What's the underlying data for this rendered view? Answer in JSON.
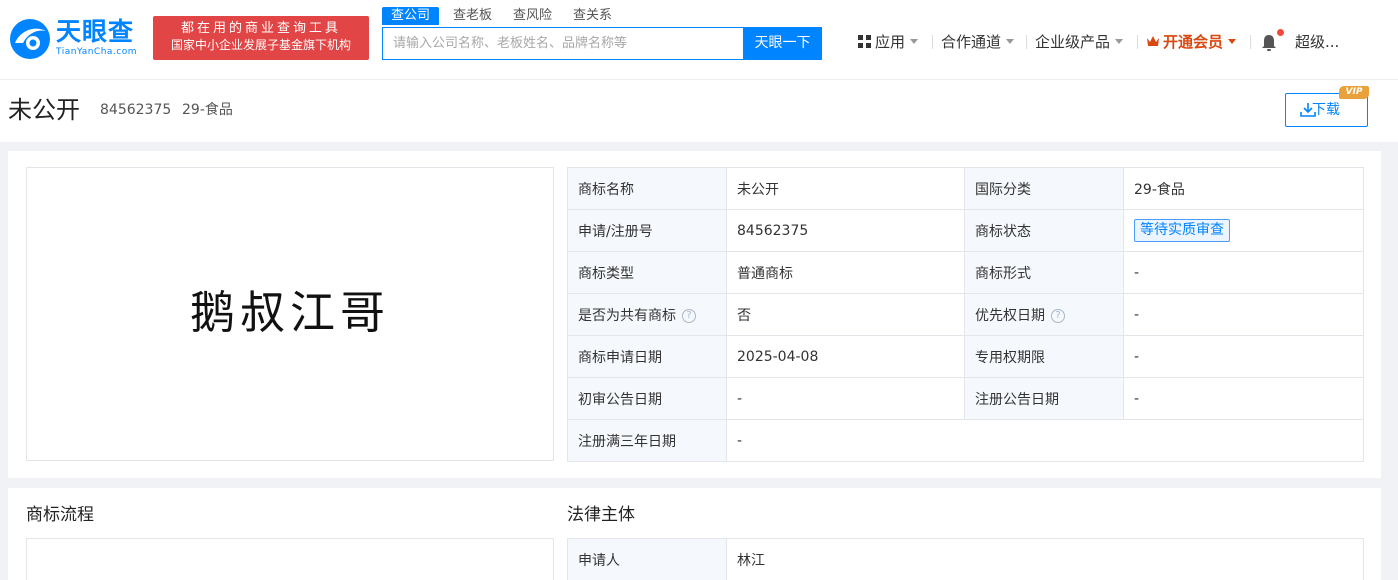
{
  "header": {
    "logo_text": "天眼查",
    "logo_sub": "TianYanCha.com",
    "slogan_line1": "都在用的商业查询工具",
    "slogan_line2": "国家中小企业发展子基金旗下机构",
    "search_tabs": [
      "查公司",
      "查老板",
      "查风险",
      "查关系"
    ],
    "search_placeholder": "请输入公司名称、老板姓名、品牌名称等",
    "search_button": "天眼一下",
    "nav_apps": "应用",
    "nav_partner": "合作通道",
    "nav_enterprise": "企业级产品",
    "nav_vip": "开通会员",
    "nav_user": "超级..."
  },
  "title_bar": {
    "name": "未公开",
    "reg_no": "84562375",
    "class": "29-食品",
    "download_label": "下载",
    "vip_tag": "VIP"
  },
  "trademark": {
    "image_text": "鹅叔江哥"
  },
  "info_table": {
    "rows": [
      [
        "商标名称",
        "未公开",
        "国际分类",
        "29-食品"
      ],
      [
        "申请/注册号",
        "84562375",
        "商标状态",
        "等待实质审查"
      ],
      [
        "商标类型",
        "普通商标",
        "商标形式",
        "-"
      ],
      [
        "是否为共有商标",
        "否",
        "优先权日期",
        "-"
      ],
      [
        "商标申请日期",
        "2025-04-08",
        "专用权期限",
        "-"
      ],
      [
        "初审公告日期",
        "-",
        "注册公告日期",
        "-"
      ],
      [
        "注册满三年日期",
        "-"
      ]
    ],
    "help_icon": "?"
  },
  "sections": {
    "flow_title": "商标流程",
    "legal_title": "法律主体"
  },
  "legal_table": {
    "applicant_label": "申请人",
    "applicant_value": "林江"
  },
  "colors": {
    "brand_blue": "#0084ff",
    "slogan_red": "#e14545",
    "vip_orange": "#d9480f"
  }
}
